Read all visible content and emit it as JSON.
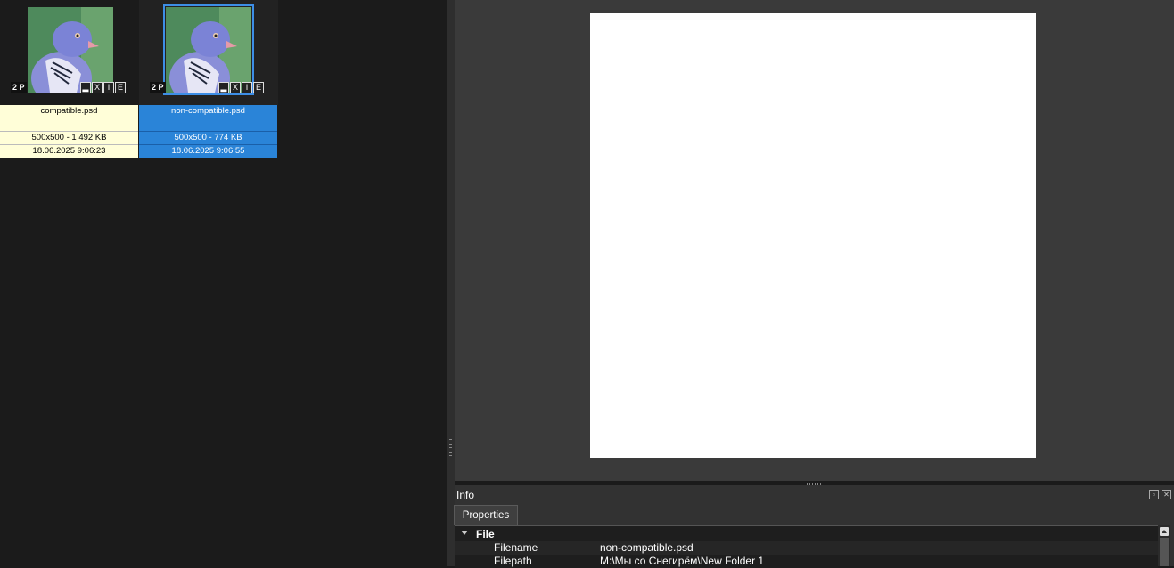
{
  "browser": {
    "thumbnails": [
      {
        "page_badge": "2 P",
        "flags": [
          "▂",
          "X",
          "I",
          "E"
        ],
        "filename": "compatible.psd",
        "line2": "",
        "size": "500x500 - 1 492 KB",
        "date": "18.06.2025 9:06:23"
      },
      {
        "page_badge": "2 P",
        "flags": [
          "▂",
          "X",
          "I",
          "E"
        ],
        "filename": "non-compatible.psd",
        "line2": "",
        "size": "500x500 - 774 KB",
        "date": "18.06.2025 9:06:55"
      }
    ]
  },
  "info_panel": {
    "title": "Info",
    "tab": "Properties",
    "group": "File",
    "rows": [
      {
        "name": "Filename",
        "value": "non-compatible.psd"
      },
      {
        "name": "Filepath",
        "value": "M:\\Мы со Снегирём\\New Folder 1"
      }
    ]
  },
  "colors": {
    "selection": "#2a84d8",
    "info_bg": "#fffed8",
    "viewer_bg": "#3a3a3a"
  }
}
